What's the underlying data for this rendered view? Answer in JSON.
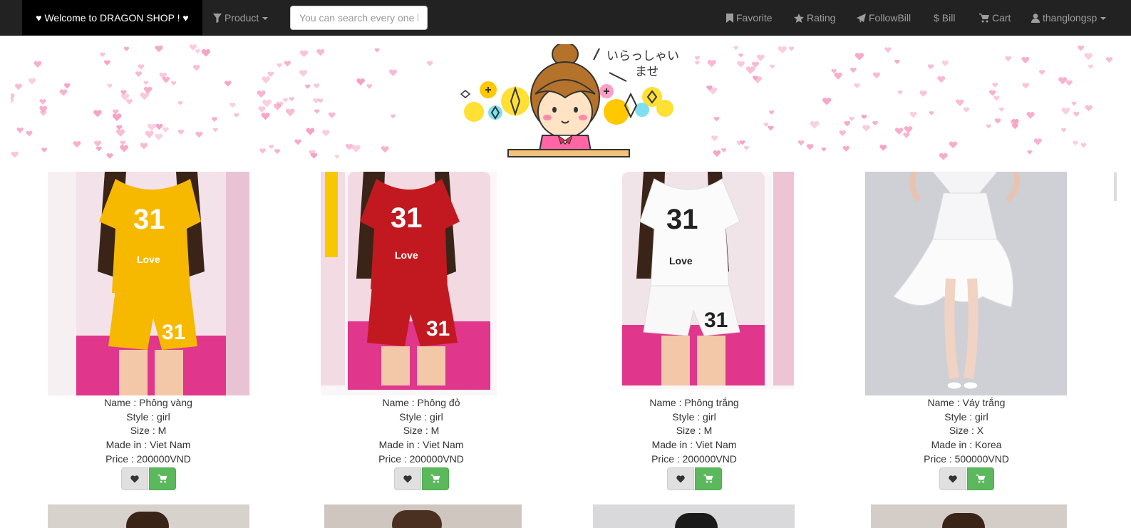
{
  "navbar": {
    "brand": "♥ Welcome to DRAGON SHOP ! ♥",
    "product_menu": "Product",
    "search_placeholder": "You can search every one here",
    "links": {
      "favorite": "Favorite",
      "rating": "Rating",
      "followbill": "FollowBill",
      "bill": "Bill",
      "cart": "Cart",
      "user": "thanglongsp"
    }
  },
  "banner": {
    "greeting": "いらっしゃいませ"
  },
  "colors": {
    "navbar_bg": "#222222",
    "brand_bg": "#000000",
    "cart_button": "#5cb85c",
    "favorite_button": "#e0e0e0",
    "heart_pattern": "#f7a1c4"
  },
  "products": [
    {
      "name": "Name : Phông vàng",
      "style": "Style : girl",
      "size": "Size : M",
      "made_in": "Made in : Viet Nam",
      "price": "Price : 200000VND",
      "image": "yellow-31-love-set"
    },
    {
      "name": "Name : Phông đỏ",
      "style": "Style : girl",
      "size": "Size : M",
      "made_in": "Made in : Viet Nam",
      "price": "Price : 200000VND",
      "image": "red-31-love-set"
    },
    {
      "name": "Name : Phông trắng",
      "style": "Style : girl",
      "size": "Size : M",
      "made_in": "Made in : Viet Nam",
      "price": "Price : 200000VND",
      "image": "white-31-love-set"
    },
    {
      "name": "Name : Váy trắng",
      "style": "Style : girl",
      "size": "Size : X",
      "made_in": "Made in : Korea",
      "price": "Price : 500000VND",
      "image": "white-dress"
    }
  ]
}
